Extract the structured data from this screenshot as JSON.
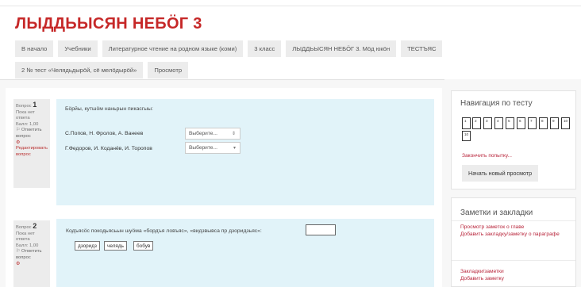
{
  "page": {
    "title": "ЛЫДДЬЫСЯН НЕБӦГ 3"
  },
  "breadcrumbs": {
    "row1": [
      "В начало",
      "Учебники",
      "Литературное чтение на родном языке (коми)",
      "3 класс",
      "ЛЫДДЬЫСЯН НЕБӦГ 3. Мӧд юкӧн",
      "ТЕСТЪЯС"
    ],
    "row2": [
      "2 № тест «Челядьдырӧй, сё мелӧдырӧй»",
      "Просмотр"
    ]
  },
  "questions": [
    {
      "label": "Вопрос",
      "number": "1",
      "status": "Пока нет ответа",
      "score": "Балл: 1,00",
      "flag": "Отметить вопрос",
      "edit": "Редактировать вопрос",
      "text": "Бӧрйы, кутшӧм наньрын пикасгыы:",
      "rows": [
        {
          "label": "С.Попов, Н. Фролов, А. Ванеев",
          "select": "Выберите..."
        },
        {
          "label": "Г.Федоров, И. Коданёв, И. Торопов",
          "select": "Выберите..."
        }
      ]
    },
    {
      "label": "Вопрос",
      "number": "2",
      "status": "Пока нет ответа",
      "score": "Балл: 1,00",
      "flag": "Отметить вопрос",
      "text": "Кодъясӧс покодьясьын шуӧма «бордъя ловъяс», «видзвывса пр дзоридзьяс»:",
      "choices": [
        "дзоридз",
        "челядь",
        "бобув"
      ]
    }
  ],
  "sidebar": {
    "nav": {
      "title": "Навигация по тесту",
      "buttons": [
        "1",
        "2",
        "3",
        "4",
        "5",
        "6",
        "7",
        "8",
        "9",
        "10"
      ],
      "finish_link": "Закончить попытку...",
      "new_preview": "Начать новый просмотр"
    },
    "notes": {
      "title": "Заметки и закладки",
      "link1": "Просмотр заметок о главе",
      "link2": "Добавить закладку/заметку о параграфе",
      "link3": "Закладки/заметки",
      "link4": "Добавить заметку"
    }
  }
}
